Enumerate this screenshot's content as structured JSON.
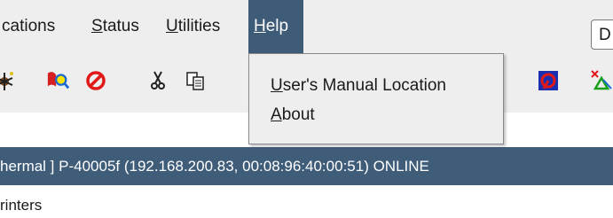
{
  "menubar": {
    "items": [
      {
        "label": "cations",
        "accel": "",
        "rest": "cations"
      },
      {
        "label": "Status",
        "accel": "S",
        "rest": "tatus"
      },
      {
        "label": "Utilities",
        "accel": "U",
        "rest": "tilities"
      },
      {
        "label": "Help",
        "accel": "H",
        "rest": "elp"
      }
    ],
    "right_button_label": "D"
  },
  "help_menu": {
    "items": [
      {
        "label": "User's Manual Location",
        "accel": "U",
        "rest": "ser's Manual Location"
      },
      {
        "label": "About",
        "accel": "A",
        "rest": "bout"
      }
    ]
  },
  "toolbar": {
    "icons": [
      "bug-icon",
      "search-person-icon",
      "stop-icon",
      "cut-icon",
      "copy-icon",
      "network-icon",
      "network-delete-icon"
    ]
  },
  "device_bar": {
    "text": "hermal ] P-40005f (192.168.200.83, 00:08:96:40:00:51) ONLINE"
  },
  "section": {
    "label": "Printers",
    "label_visible": "rinters"
  },
  "colors": {
    "menu_active_bg": "#3e5b77",
    "device_bar_bg": "#3f5c79",
    "chrome_bg": "#eeeeee"
  }
}
